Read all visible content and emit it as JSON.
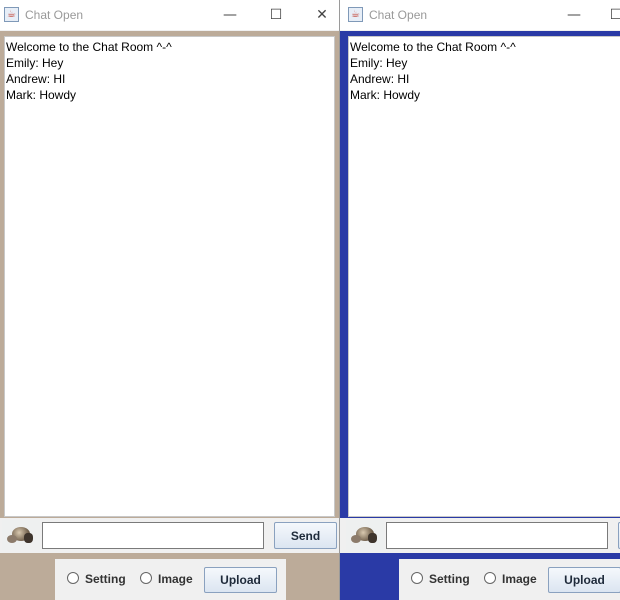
{
  "windows": [
    {
      "title": "Chat Open",
      "controls": {
        "minimize": "—",
        "maximize": "☐",
        "close": "✕"
      },
      "background_color": "#bcab99",
      "messages": [
        "Welcome to the Chat Room ^-^",
        "Emily: Hey",
        "Andrew: HI",
        "Mark: Howdy"
      ],
      "input_value": "",
      "send_label": "Send",
      "radio_setting": "Setting",
      "radio_image": "Image",
      "upload_label": "Upload"
    },
    {
      "title": "Chat Open",
      "controls": {
        "minimize": "—",
        "maximize": "☐"
      },
      "background_color": "#2a3aa6",
      "messages": [
        "Welcome to the Chat Room ^-^",
        "Emily: Hey",
        "Andrew: HI",
        "Mark: Howdy"
      ],
      "input_value": "",
      "radio_setting": "Setting",
      "radio_image": "Image",
      "upload_label": "Upload"
    }
  ]
}
